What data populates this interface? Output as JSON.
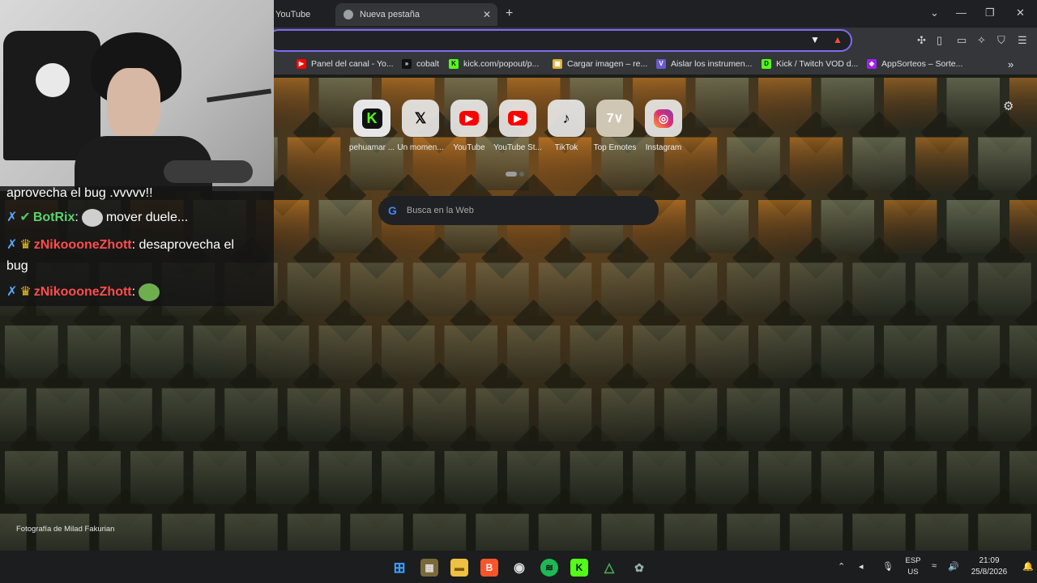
{
  "browser": {
    "tabs": [
      {
        "label": "YouTube",
        "active": false
      },
      {
        "label": "Nueva pestaña",
        "active": true
      }
    ],
    "omnibox": {
      "value": "",
      "placeholder": ""
    },
    "bookmarks": [
      {
        "label": "Panel del canal - Yo...",
        "icon": "youtube-icon",
        "color": "#ff0000"
      },
      {
        "label": "cobalt",
        "icon": "cobalt-icon",
        "color": "#111111"
      },
      {
        "label": "kick.com/popout/p...",
        "icon": "kick-icon",
        "color": "#53fc18"
      },
      {
        "label": "Cargar imagen – re...",
        "icon": "image-icon",
        "color": "#e0b030"
      },
      {
        "label": "Aislar los instrumen...",
        "icon": "vocal-remover-icon",
        "color": "#6a5acd"
      },
      {
        "label": "Kick / Twitch VOD d...",
        "icon": "vod-icon",
        "color": "#53fc18"
      },
      {
        "label": "AppSorteos – Sorte...",
        "icon": "appsorteos-icon",
        "color": "#a020f0"
      }
    ]
  },
  "newtab": {
    "shortcuts": [
      {
        "label": "pehuamar ...",
        "icon": "kick-icon",
        "glyph": "K",
        "color": "#53fc18"
      },
      {
        "label": "Un momen...",
        "icon": "x-icon",
        "glyph": "𝕏",
        "color": "#000000"
      },
      {
        "label": "YouTube",
        "icon": "youtube-icon",
        "glyph": "▶",
        "color": "#ff0000"
      },
      {
        "label": "YouTube St...",
        "icon": "youtube-studio-icon",
        "glyph": "▶",
        "color": "#ff0000"
      },
      {
        "label": "TikTok",
        "icon": "tiktok-icon",
        "glyph": "♪",
        "color": "#000000"
      },
      {
        "label": "Top Emotes",
        "icon": "7tv-icon",
        "glyph": "7∨",
        "color": "#ffffff"
      },
      {
        "label": "Instagram",
        "icon": "instagram-icon",
        "glyph": "◎",
        "color": "#e1306c"
      }
    ],
    "search_placeholder": "Busca en la Web",
    "photo_credit": "Fotografía de Milad Fakurian"
  },
  "chat": {
    "lines": [
      {
        "text": "aprovecha el bug .vvvvv!!"
      },
      {
        "user": "BotRix",
        "message": "mover duele..."
      },
      {
        "user": "zNikoooneZhott",
        "message": "desaprovecha el",
        "continuation": "bug"
      },
      {
        "user": "zNikoooneZhott",
        "message": ""
      }
    ]
  },
  "taskbar": {
    "language": "ESP",
    "layout": "US",
    "time": "21:09",
    "date": "25/8/2026"
  }
}
